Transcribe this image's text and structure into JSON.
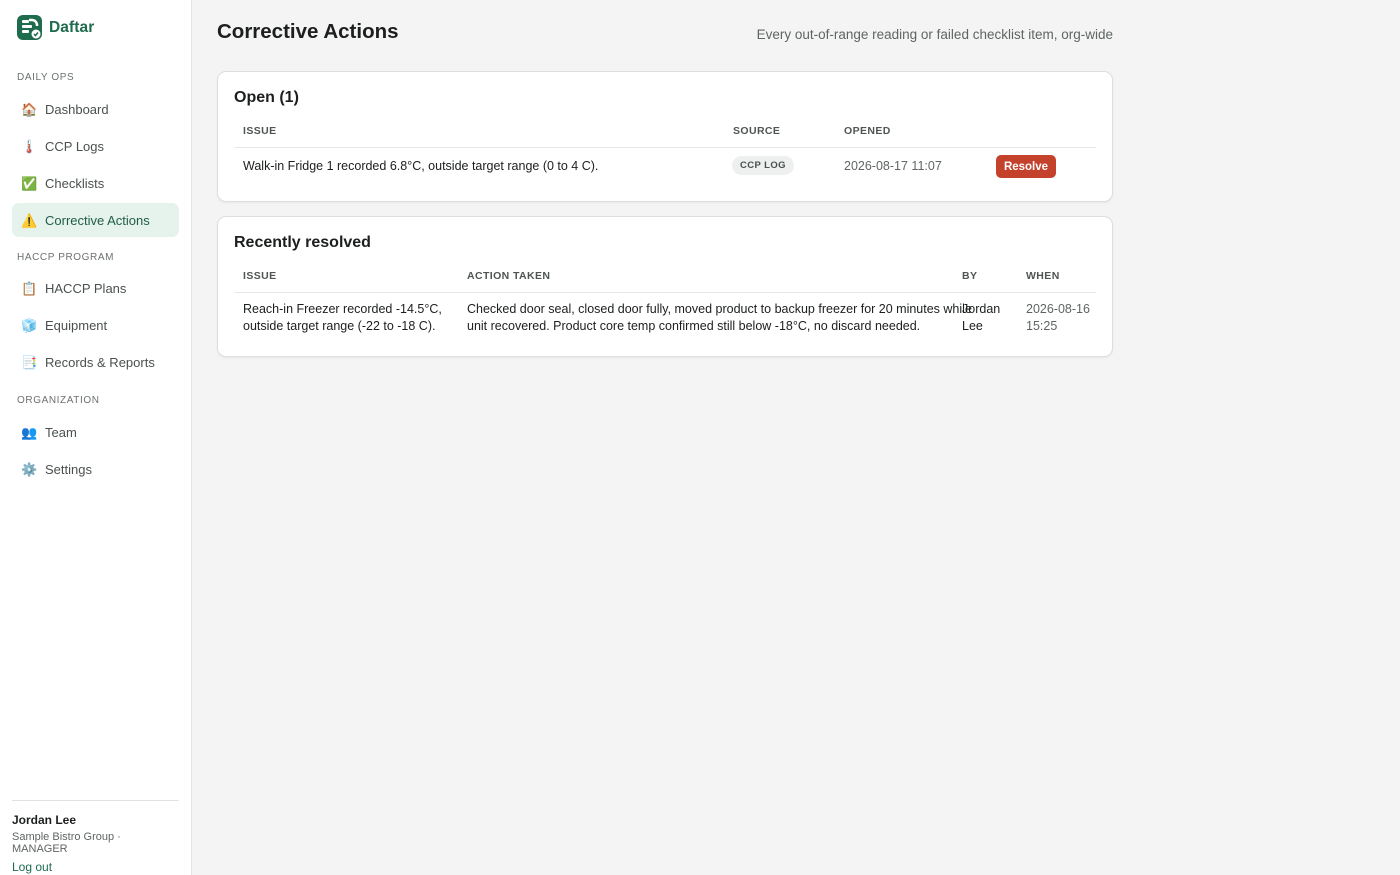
{
  "app": {
    "name": "Daftar"
  },
  "sidebar": {
    "sections": [
      {
        "label": "DAILY OPS"
      },
      {
        "label": "HACCP PROGRAM"
      },
      {
        "label": "ORGANIZATION"
      }
    ],
    "items": [
      {
        "label": "Dashboard",
        "icon": "house-icon",
        "glyph": "🏠"
      },
      {
        "label": "CCP Logs",
        "icon": "thermometer-icon",
        "glyph": "🌡️"
      },
      {
        "label": "Checklists",
        "icon": "check-box-icon",
        "glyph": "✅"
      },
      {
        "label": "Corrective Actions",
        "icon": "warning-icon",
        "glyph": "⚠️",
        "active": true
      },
      {
        "label": "HACCP Plans",
        "icon": "clipboard-icon",
        "glyph": "📋"
      },
      {
        "label": "Equipment",
        "icon": "ice-cube-icon",
        "glyph": "🧊"
      },
      {
        "label": "Records & Reports",
        "icon": "bookmark-tabs-icon",
        "glyph": "📑"
      },
      {
        "label": "Team",
        "icon": "people-icon",
        "glyph": "👥"
      },
      {
        "label": "Settings",
        "icon": "gear-icon",
        "glyph": "⚙️"
      }
    ]
  },
  "user": {
    "name": "Jordan Lee",
    "org": "Sample Bistro Group · MANAGER",
    "logout_label": "Log out"
  },
  "header": {
    "title": "Corrective Actions",
    "subtitle": "Every out-of-range reading or failed checklist item, org-wide"
  },
  "open_card": {
    "title": "Open (1)",
    "columns": [
      "ISSUE",
      "SOURCE",
      "OPENED"
    ],
    "rows": [
      {
        "issue": "Walk-in Fridge 1 recorded 6.8°C, outside target range (0 to 4 C).",
        "source": "CCP LOG",
        "opened": "2026-08-17 11:07",
        "action_label": "Resolve"
      }
    ]
  },
  "resolved_card": {
    "title": "Recently resolved",
    "columns": [
      "ISSUE",
      "ACTION TAKEN",
      "BY",
      "WHEN"
    ],
    "rows": [
      {
        "issue_line1": "Reach-in Freezer recorded -14.5°C,",
        "issue_line2": "outside target range (-22 to -18 C).",
        "action_line1": "Checked door seal, closed door fully, moved product to backup freezer for 20 minutes while",
        "action_line2": "unit recovered. Product core temp confirmed still below -18°C, no discard needed.",
        "by_line1": "Jordan",
        "by_line2": "Lee",
        "when_line1": "2026-08-16",
        "when_line2": "15:25"
      }
    ]
  },
  "colors": {
    "brand": "#1f6b4e",
    "active_bg": "#e6f2ec",
    "danger": "#c4412b"
  }
}
